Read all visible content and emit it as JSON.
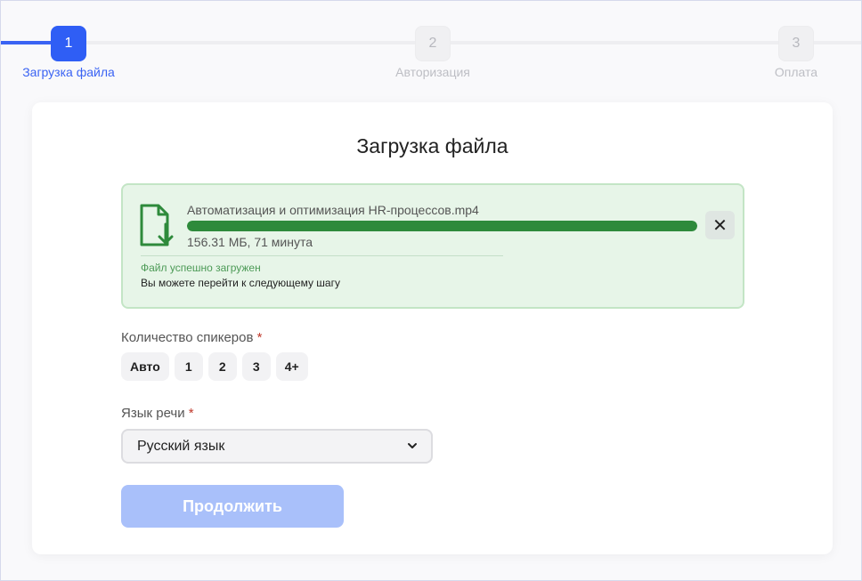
{
  "stepper": {
    "steps": [
      {
        "number": "1",
        "label": "Загрузка файла",
        "state": "active"
      },
      {
        "number": "2",
        "label": "Авторизация",
        "state": "inactive"
      },
      {
        "number": "3",
        "label": "Оплата",
        "state": "inactive"
      }
    ]
  },
  "card": {
    "title": "Загрузка файла",
    "file": {
      "name": "Автоматизация и оптимизация HR-процессов.mp4",
      "meta": "156.31 МБ, 71 минута",
      "progress_percent": 100,
      "status": "Файл успешно загружен",
      "hint": "Вы можете перейти к следующему шагу",
      "close_symbol": "✕",
      "icon": "file-download-icon"
    },
    "speakers": {
      "label": "Количество спикеров",
      "required_mark": "*",
      "options": [
        "Авто",
        "1",
        "2",
        "3",
        "4+"
      ]
    },
    "language": {
      "label": "Язык речи",
      "required_mark": "*",
      "selected": "Русский язык"
    },
    "continue_label": "Продолжить"
  },
  "colors": {
    "accent": "#2f5ef5",
    "success": "#2e8a3b",
    "success_bg": "#e7f5e8",
    "button_disabled": "#a9c0fa"
  }
}
